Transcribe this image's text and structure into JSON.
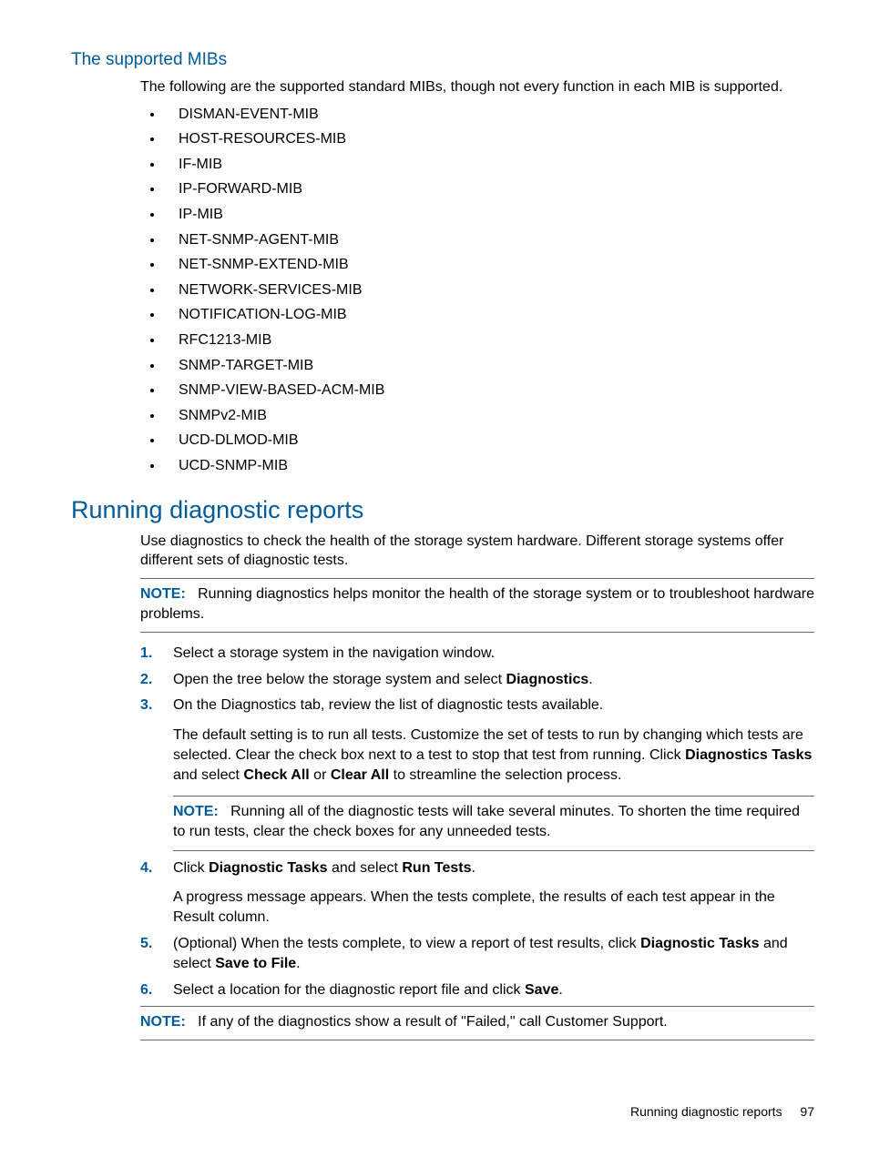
{
  "section1": {
    "heading": "The supported MIBs",
    "intro": "The following are the supported standard MIBs, though not every function in each MIB is supported.",
    "items": [
      "DISMAN-EVENT-MIB",
      "HOST-RESOURCES-MIB",
      "IF-MIB",
      "IP-FORWARD-MIB",
      "IP-MIB",
      "NET-SNMP-AGENT-MIB",
      "NET-SNMP-EXTEND-MIB",
      "NETWORK-SERVICES-MIB",
      "NOTIFICATION-LOG-MIB",
      "RFC1213-MIB",
      "SNMP-TARGET-MIB",
      "SNMP-VIEW-BASED-ACM-MIB",
      "SNMPv2-MIB",
      "UCD-DLMOD-MIB",
      "UCD-SNMP-MIB"
    ]
  },
  "section2": {
    "heading": "Running diagnostic reports",
    "intro": "Use diagnostics to check the health of the storage system hardware. Different storage systems offer different sets of diagnostic tests.",
    "note_label": "NOTE:",
    "note1": "Running diagnostics helps monitor the health of the storage system or to troubleshoot hardware problems.",
    "steps": {
      "s1": "Select a storage system in the navigation window.",
      "s2_a": "Open the tree below the storage system and select ",
      "s2_b": "Diagnostics",
      "s2_c": ".",
      "s3_a": "On the Diagnostics tab, review the list of diagnostic tests available.",
      "s3_p1a": "The default setting is to run all tests. Customize the set of tests to run by changing which tests are selected. Clear the check box next to a test to stop that test from running. Click ",
      "s3_p1b": "Diagnostics Tasks",
      "s3_p1c": " and select ",
      "s3_p1d": "Check All",
      "s3_p1e": " or ",
      "s3_p1f": "Clear All",
      "s3_p1g": " to streamline the selection process.",
      "s3_note": "Running all of the diagnostic tests will take several minutes. To shorten the time required to run tests, clear the check boxes for any unneeded tests.",
      "s4_a": "Click ",
      "s4_b": "Diagnostic Tasks",
      "s4_c": " and select ",
      "s4_d": "Run Tests",
      "s4_e": ".",
      "s4_p1": "A progress message appears. When the tests complete, the results of each test appear in the Result column.",
      "s5_a": "(Optional) When the tests complete, to view a report of test results, click ",
      "s5_b": "Diagnostic Tasks",
      "s5_c": " and select ",
      "s5_d": "Save to File",
      "s5_e": ".",
      "s6_a": "Select a location for the diagnostic report file and click ",
      "s6_b": "Save",
      "s6_c": "."
    },
    "note2": "If any of the diagnostics show a result of \"Failed,\" call Customer Support."
  },
  "footer": {
    "title": "Running diagnostic reports",
    "page": "97"
  }
}
